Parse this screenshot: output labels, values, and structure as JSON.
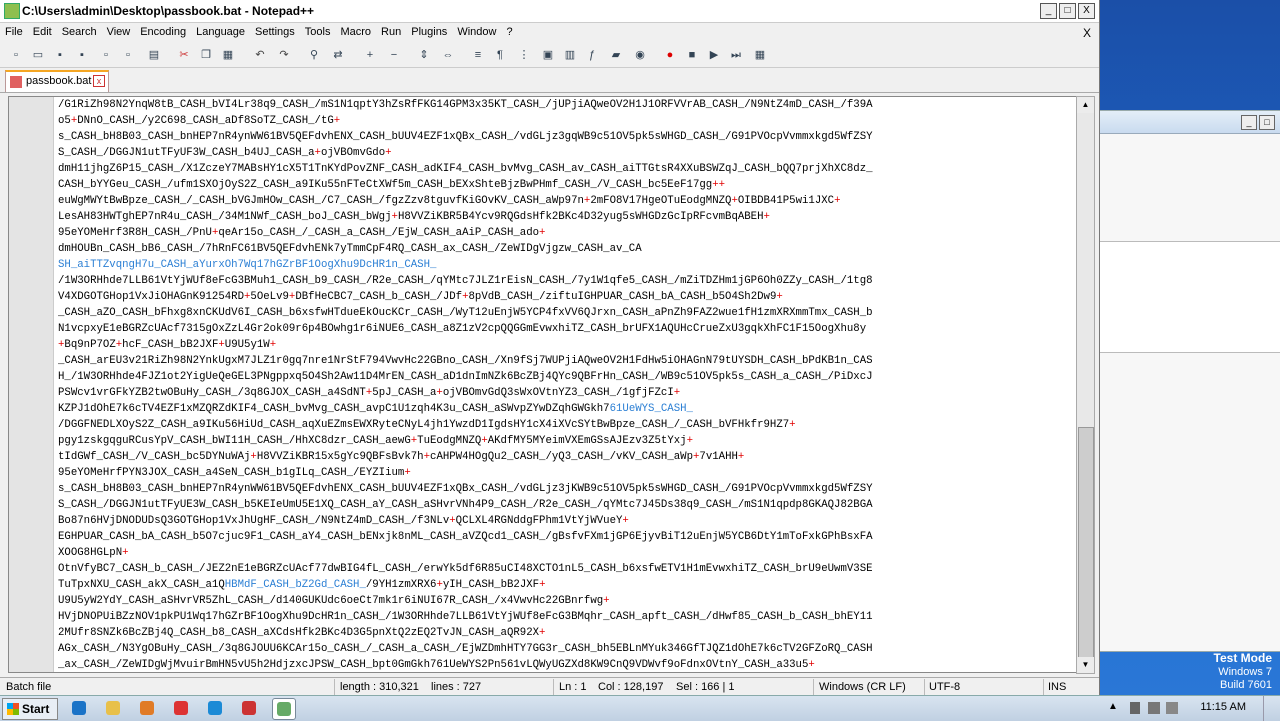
{
  "window": {
    "title": "C:\\Users\\admin\\Desktop\\passbook.bat - Notepad++",
    "controls": {
      "minimize": "_",
      "maximize": "□",
      "close": "X"
    }
  },
  "menu": {
    "items": [
      "File",
      "Edit",
      "Search",
      "View",
      "Encoding",
      "Language",
      "Settings",
      "Tools",
      "Macro",
      "Run",
      "Plugins",
      "Window",
      "?"
    ],
    "close": "X"
  },
  "toolbar": {
    "icons": [
      "new-file-icon",
      "open-file-icon",
      "save-icon",
      "save-all-icon",
      "close-icon",
      "close-all-icon",
      "print-icon",
      "cut-icon",
      "copy-icon",
      "paste-icon",
      "undo-icon",
      "redo-icon",
      "find-icon",
      "replace-icon",
      "zoom-in-icon",
      "zoom-out-icon",
      "sync-v-icon",
      "sync-h-icon",
      "wrap-icon",
      "all-chars-icon",
      "indent-guide-icon",
      "udl-icon",
      "doc-map-icon",
      "function-list-icon",
      "folder-workspace-icon",
      "monitor-icon",
      "record-macro-icon",
      "stop-macro-icon",
      "play-macro-icon",
      "run-multiple-macro-icon",
      "save-macro-icon"
    ]
  },
  "tab": {
    "label": "passbook.bat",
    "close": "x"
  },
  "editor": {
    "lines": [
      [
        [
          "t",
          "/G1RiZh98N2YnqW8tB_CASH_bVI4Lr38q9_CASH_/mS1N1qptY3hZsRfFKG14GPM3x35KT_CASH_/jUPjiAQweOV2H1J1ORFVVrAB_CASH_/N9NtZ4mD_CASH_/f39A"
        ]
      ],
      [
        [
          "t",
          "o5"
        ],
        [
          "p",
          "+"
        ],
        [
          "t",
          "DNnO_CASH_/y2C698_CASH_aDf8SoTZ_CASH_/tG"
        ],
        [
          "p",
          "+"
        ]
      ],
      [
        [
          "t",
          "s_CASH_bH8B03_CASH_bnHEP7nR4ynWW61BV5QEFdvhENX_CASH_bUUV4EZF1xQBx_CASH_/vdGLjz3gqWB9c51OV5pk5sWHGD_CASH_/G91PVOcpVvmmxkgd5WfZSY"
        ]
      ],
      [
        [
          "t",
          "S_CASH_/DGGJN1utTFyUF3W_CASH_b4UJ_CASH_a"
        ],
        [
          "p",
          "+"
        ],
        [
          "t",
          "ojVBOmvGdo"
        ],
        [
          "p",
          "+"
        ]
      ],
      [
        [
          "t",
          "dmH11jhgZ6P15_CASH_/X1ZczeY7MABsHY1cX5T1TnKYdPovZNF_CASH_adKIF4_CASH_bvMvg_CASH_av_CASH_aiTTGtsR4XXuBSWZqJ_CASH_bQQ7prjXhXC8dz_"
        ]
      ],
      [
        [
          "t",
          "CASH_bYYGeu_CASH_/ufm1SXOjOyS2Z_CASH_a9IKu55nFTeCtXWf5m_CASH_bEXxShteBjzBwPHmf_CASH_/V_CASH_bc5EeF17gg"
        ],
        [
          "p",
          "++"
        ]
      ],
      [
        [
          "t",
          "euWgMWYtBwBpze_CASH_/_CASH_bVGJmHOw_CASH_/C7_CASH_/fgzZzv8tguvfKiGOvKV_CASH_aWp97n"
        ],
        [
          "p",
          "+"
        ],
        [
          "t",
          "2mFO8V17HgeOTuEodgMNZQ"
        ],
        [
          "p",
          "+"
        ],
        [
          "t",
          "OIBDB41P5wi1JXC"
        ],
        [
          "p",
          "+"
        ]
      ],
      [
        [
          "t",
          "LesAH83HWTghEP7nR4u_CASH_/34M1NWf_CASH_boJ_CASH_bWgj"
        ],
        [
          "p",
          "+"
        ],
        [
          "t",
          "H8VVZiKBR5B4Ycv9RQGdsHfk2BKc4D32yug5sWHGDzGcIpRFcvmBqABEH"
        ],
        [
          "p",
          "+"
        ]
      ],
      [
        [
          "t",
          "95eYOMeHrf3R8H_CASH_/PnU"
        ],
        [
          "p",
          "+"
        ],
        [
          "t",
          "qeAr15o_CASH_/_CASH_a_CASH_/EjW_CASH_aAiP_CASH_ado"
        ],
        [
          "p",
          "+"
        ]
      ],
      [
        [
          "t",
          "dmHOUBn_CASH_bB6_CASH_/7hRnFC61BV5QEFdvhENk7yTmmCpF4RQ_CASH_ax_CASH_/ZeWIDgVjgzw_CASH_av_CA"
        ]
      ],
      [
        [
          "s",
          "SH_aiTTZvqngH7u_CASH_aYurxOh7Wq17hGZrBF1OogXhu9DcHR1n_CASH_"
        ]
      ],
      [
        [
          "t",
          "/1W3ORHhde7LLB61VtYjWUf8eFcG3BMuh1_CASH_b9_CASH_/R2e_CASH_/qYMtc7JLZ1rEisN_CASH_/7y1W1qfe5_CASH_/mZiTDZHm1jGP6Oh0ZZy_CASH_/1tg8"
        ]
      ],
      [
        [
          "t",
          "V4XDGOTGHop1VxJiOHAGnK91254RD"
        ],
        [
          "p",
          "+"
        ],
        [
          "t",
          "5OeLv9"
        ],
        [
          "p",
          "+"
        ],
        [
          "t",
          "DBfHeCBC7_CASH_b_CASH_/JDf"
        ],
        [
          "p",
          "+"
        ],
        [
          "t",
          "8pVdB_CASH_/ziftuIGHPUAR_CASH_bA_CASH_b5O4Sh2Dw9"
        ],
        [
          "p",
          "+"
        ]
      ],
      [
        [
          "t",
          "_CASH_aZO_CASH_bFhxg8xnCKUdV6I_CASH_b6xsfwHTdueEkOucKCr_CASH_/WyT12uEnjW5YCP4fxVV6QJrxn_CASH_aPnZh9FAZ2wue1fH1zmXRXmmTmx_CASH_b"
        ]
      ],
      [
        [
          "t",
          "N1vcpxyE1eBGRZcUAcf7315gOxZzL4Gr2ok09r6p4BOwhg1r6iNUE6_CASH_a8Z1zV2cpQQGGmEvwxhiTZ_CASH_brUFX1AQUHcCrueZxU3gqkXhFC1F15OogXhu8y"
        ]
      ],
      [
        [
          "p",
          "+"
        ],
        [
          "t",
          "Bq9nP7OZ"
        ],
        [
          "p",
          "+"
        ],
        [
          "t",
          "hcF_CASH_bB2JXF"
        ],
        [
          "p",
          "+"
        ],
        [
          "t",
          "U9U5y1W"
        ],
        [
          "p",
          "+"
        ]
      ],
      [
        [
          "t",
          "_CASH_arEU3v21RiZh98N2YnkUgxM7JLZ1r0gq7nre1NrStF794VwvHc22GBno_CASH_/Xn9fSj7WUPjiAQweOV2H1FdHw5iOHAGnN79tUYSDH_CASH_bPdKB1n_CAS"
        ]
      ],
      [
        [
          "t",
          "H_/1W3ORHhde4FJZ1ot2YigUeQeGEL3PNgppxq5O4Sh2Aw11D4MrEN_CASH_aD1dnImNZk6BcZBj4QYc9QBFrHn_CASH_/WB9c51OV5pk5s_CASH_a_CASH_/PiDxcJ"
        ]
      ],
      [
        [
          "t",
          "PSWcv1vrGFkYZB2twOBuHy_CASH_/3q8GJOX_CASH_a4SdNT"
        ],
        [
          "p",
          "+"
        ],
        [
          "t",
          "5pJ_CASH_a"
        ],
        [
          "p",
          "+"
        ],
        [
          "t",
          "ojVBOmvGdQ3sWxOVtnYZ3_CASH_/1gfjFZcI"
        ],
        [
          "p",
          "+"
        ]
      ],
      [
        [
          "t",
          "KZPJ1dOhE7k6cTV4EZF1xMZQRZdKIF4_CASH_bvMvg_CASH_avpC1U1zqh4K3u_CASH_aSWvpZYwDZqhGWGkh7"
        ],
        [
          "s",
          "61UeWYS_CASH_"
        ]
      ],
      [
        [
          "t",
          "/DGGFNEDLXOyS2Z_CASH_a9IKu56HiUd_CASH_aqXuEZmsEWXRyteCNyL4jh1YwzdD1IgdsHY1cX4iXVcSYtBwBpze_CASH_/_CASH_bVFHkfr9HZ7"
        ],
        [
          "p",
          "+"
        ]
      ],
      [
        [
          "t",
          "pgy1zskgqguRCusYpV_CASH_bWI11H_CASH_/HhXC8dzr_CASH_aewG"
        ],
        [
          "p",
          "+"
        ],
        [
          "t",
          "TuEodgMNZQ"
        ],
        [
          "p",
          "+"
        ],
        [
          "t",
          "AKdfMY5MYeimVXEmGSsAJEzv3Z5tYxj"
        ],
        [
          "p",
          "+"
        ]
      ],
      [
        [
          "t",
          "tIdGWf_CASH_/V_CASH_bc5DYNuWAj"
        ],
        [
          "p",
          "+"
        ],
        [
          "t",
          "H8VVZiKBR15x5gYc9QBFsBvk7h"
        ],
        [
          "p",
          "+"
        ],
        [
          "t",
          "cAHPW4HOgQu2_CASH_/yQ3_CASH_/vKV_CASH_aWp"
        ],
        [
          "p",
          "+"
        ],
        [
          "t",
          "7v1AHH"
        ],
        [
          "p",
          "+"
        ]
      ],
      [
        [
          "t",
          "95eYOMeHrfPYN3JOX_CASH_a4SeN_CASH_b1gILq_CASH_/EYZIium"
        ],
        [
          "p",
          "+"
        ]
      ],
      [
        [
          "t",
          "s_CASH_bH8B03_CASH_bnHEP7nR4ynWW61BV5QEFdvhENX_CASH_bUUV4EZF1xQBx_CASH_/vdGLjz3jKWB9c51OV5pk5sWHGD_CASH_/G91PVOcpVvmmxkgd5WfZSY"
        ]
      ],
      [
        [
          "t",
          "S_CASH_/DGGJN1utTFyUE3W_CASH_b5KEIeUmU5E1XQ_CASH_aY_CASH_aSHvrVNh4P9_CASH_/R2e_CASH_/qYMtc7J45Ds38q9_CASH_/mS1N1qpdp8GKAQJ82BGA"
        ]
      ],
      [
        [
          "t",
          "Bo87n6HVjDNODUDsQ3GOTGHop1VxJhUgHF_CASH_/N9NtZ4mD_CASH_/f3NLv"
        ],
        [
          "p",
          "+"
        ],
        [
          "t",
          "QCLXL4RGNddgFPhm1VtYjWVueY"
        ],
        [
          "p",
          "+"
        ]
      ],
      [
        [
          "t",
          "EGHPUAR_CASH_bA_CASH_b5O7cjuc9F1_CASH_aY4_CASH_bENxjk8nML_CASH_aVZQcd1_CASH_/gBsfvFXm1jGP6EjyvBiT12uEnjW5YCB6DtY1mToFxkGPhBsxFA"
        ]
      ],
      [
        [
          "t",
          "XOOG8HGLpN"
        ],
        [
          "p",
          "+"
        ]
      ],
      [
        [
          "t",
          "OtnVfyBC7_CASH_b_CASH_/JEZ2nE1eBGRZcUAcf77dwBIG4fL_CASH_/erwYk5df6R85uCI48XCTO1nL5_CASH_b6xsfwETV1H1mEvwxhiTZ_CASH_brU9eUwmV3SE"
        ]
      ],
      [
        [
          "t",
          "TuTpxNXU_CASH_akX_CASH_a1Q"
        ],
        [
          "s",
          "HBMdF_CASH_bZ2Gd_CASH_"
        ],
        [
          "t",
          "/9YH1zmXRX6"
        ],
        [
          "p",
          "+"
        ],
        [
          "t",
          "yIH_CASH_bB2JXF"
        ],
        [
          "p",
          "+"
        ]
      ],
      [
        [
          "t",
          "U9U5yW2YdY_CASH_aSHvrVR5ZhL_CASH_/d140GUKUdc6oeCt7mk1r6iNUI67R_CASH_/x4VwvHc22GBnrfwg"
        ],
        [
          "p",
          "+"
        ]
      ],
      [
        [
          "t",
          "HVjDNOPUiBZzNOV1pkPU1Wq17hGZrBF1OogXhu9DcHR1n_CASH_/1W3ORHhde7LLB61VtYjWUf8eFcG3BMqhr_CASH_apft_CASH_/dHwf85_CASH_b_CASH_bhEY11"
        ]
      ],
      [
        [
          "t",
          "2MUfr8SNZk6BcZBj4Q_CASH_b8_CASH_aXCdsHfk2BKc4D3G5pnXtQ2zEQ2TvJN_CASH_aQR92X"
        ],
        [
          "p",
          "+"
        ]
      ],
      [
        [
          "t",
          "AGx_CASH_/N3YgOBuHy_CASH_/3q8GJOUU6KCAr15o_CASH_/_CASH_a_CASH_/EjWZDmhHTY7GG3r_CASH_bh5EBLnMYuk346GfTJQZ1dOhE7k6cTV2GFZoRQ_CASH"
        ]
      ],
      [
        [
          "t",
          "_ax_CASH_/ZeWIDgWjMvuirBmHN5vU5h2HdjzxcJPSW_CASH_bpt0GmGkh761UeWYS2Pn561vLQWyUGZXd8KW9CnQ9VDWvf9oFdnxOVtnY_CASH_a33u5"
        ],
        [
          "p",
          "+"
        ]
      ]
    ]
  },
  "status": {
    "type": "Batch file",
    "length": "length : 310,321",
    "lines": "lines : 727",
    "ln": "Ln : 1",
    "col": "Col : 128,197",
    "sel": "Sel : 166 | 1",
    "eol": "Windows (CR LF)",
    "encoding": "UTF-8",
    "mode": "INS"
  },
  "desktop": {
    "testmode": "Test Mode",
    "os": "Windows 7",
    "build": "Build 7601"
  },
  "taskbar": {
    "start": "Start",
    "apps": [
      "ie-icon",
      "explorer-icon",
      "media-player-icon",
      "chrome-icon",
      "edge-icon",
      "app-grid-icon",
      "notepadpp-icon"
    ],
    "clock": "11:15 AM"
  },
  "colors": {
    "plus": "#e00000",
    "selection_text": "#2b7fd4",
    "accent": "#f5a623"
  }
}
